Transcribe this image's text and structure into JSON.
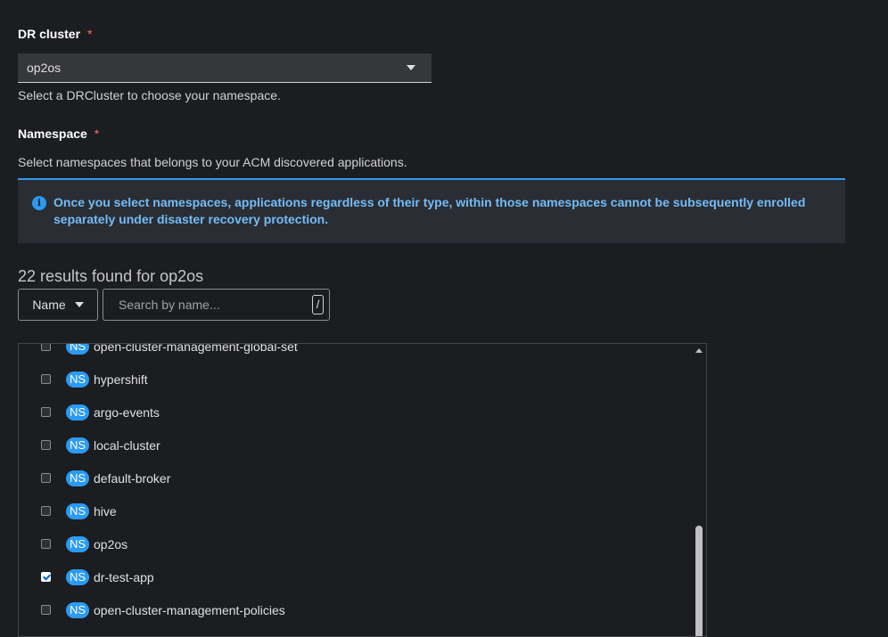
{
  "dr_cluster": {
    "label": "DR cluster",
    "required_mark": "*",
    "selected": "op2os",
    "helper": "Select a DRCluster to choose your namespace."
  },
  "namespace": {
    "label": "Namespace",
    "required_mark": "*",
    "helper": "Select namespaces that belongs to your ACM discovered applications."
  },
  "alert": {
    "icon": "info-icon",
    "text": "Once you select namespaces, applications regardless of their type, within those namespaces cannot be subsequently enrolled separately under disaster recovery protection."
  },
  "results": {
    "summary": "22 results found for op2os"
  },
  "filter": {
    "type_label": "Name",
    "search_placeholder": "Search by name...",
    "shortcut_key": "/"
  },
  "namespaces": {
    "badge": "NS",
    "items": [
      {
        "name": "open-cluster-management-global-set",
        "checked": false
      },
      {
        "name": "hypershift",
        "checked": false
      },
      {
        "name": "argo-events",
        "checked": false
      },
      {
        "name": "local-cluster",
        "checked": false
      },
      {
        "name": "default-broker",
        "checked": false
      },
      {
        "name": "hive",
        "checked": false
      },
      {
        "name": "op2os",
        "checked": false
      },
      {
        "name": "dr-test-app",
        "checked": true
      },
      {
        "name": "open-cluster-management-policies",
        "checked": false
      }
    ]
  },
  "colors": {
    "background": "#1b1d21",
    "accent": "#2b9af3",
    "alert_text": "#73bcf7",
    "required": "#ff6b60"
  }
}
